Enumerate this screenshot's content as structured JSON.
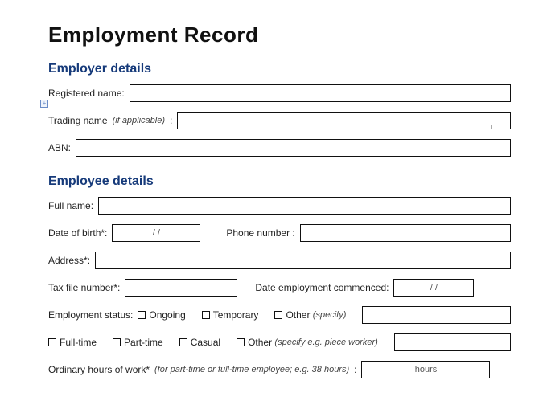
{
  "title": "Employment Record",
  "employer": {
    "heading": "Employer details",
    "registered_label": "Registered name:",
    "registered_value": "",
    "trading_label": "Trading name",
    "trading_hint": "(if applicable)",
    "trading_colon": ":",
    "trading_value": "",
    "abn_label": "ABN:",
    "abn_value": ""
  },
  "employee": {
    "heading": "Employee details",
    "fullname_label": "Full name:",
    "fullname_value": "",
    "dob_label": "Date of birth*:",
    "dob_value": "/        /",
    "phone_label": "Phone number  :",
    "phone_value": "",
    "address_label": "Address*:",
    "address_value": "",
    "tfn_label": "Tax file number*:",
    "tfn_value": "",
    "commenced_label": "Date employment commenced:",
    "commenced_value": "/        /",
    "status_label": "Employment status:",
    "status_options": {
      "ongoing": "Ongoing",
      "temporary": "Temporary",
      "other": "Other",
      "other_hint": "(specify)"
    },
    "status_other_value": "",
    "type_options": {
      "fulltime": "Full-time",
      "parttime": "Part-time",
      "casual": "Casual",
      "other": "Other",
      "other_hint": "(specify e.g. piece worker)"
    },
    "type_other_value": "",
    "hours_label": "Ordinary hours of work*",
    "hours_hint": "(for part-time or full-time employee; e.g. 38 hours)",
    "hours_colon": ":",
    "hours_suffix": "hours",
    "hours_value": ""
  }
}
